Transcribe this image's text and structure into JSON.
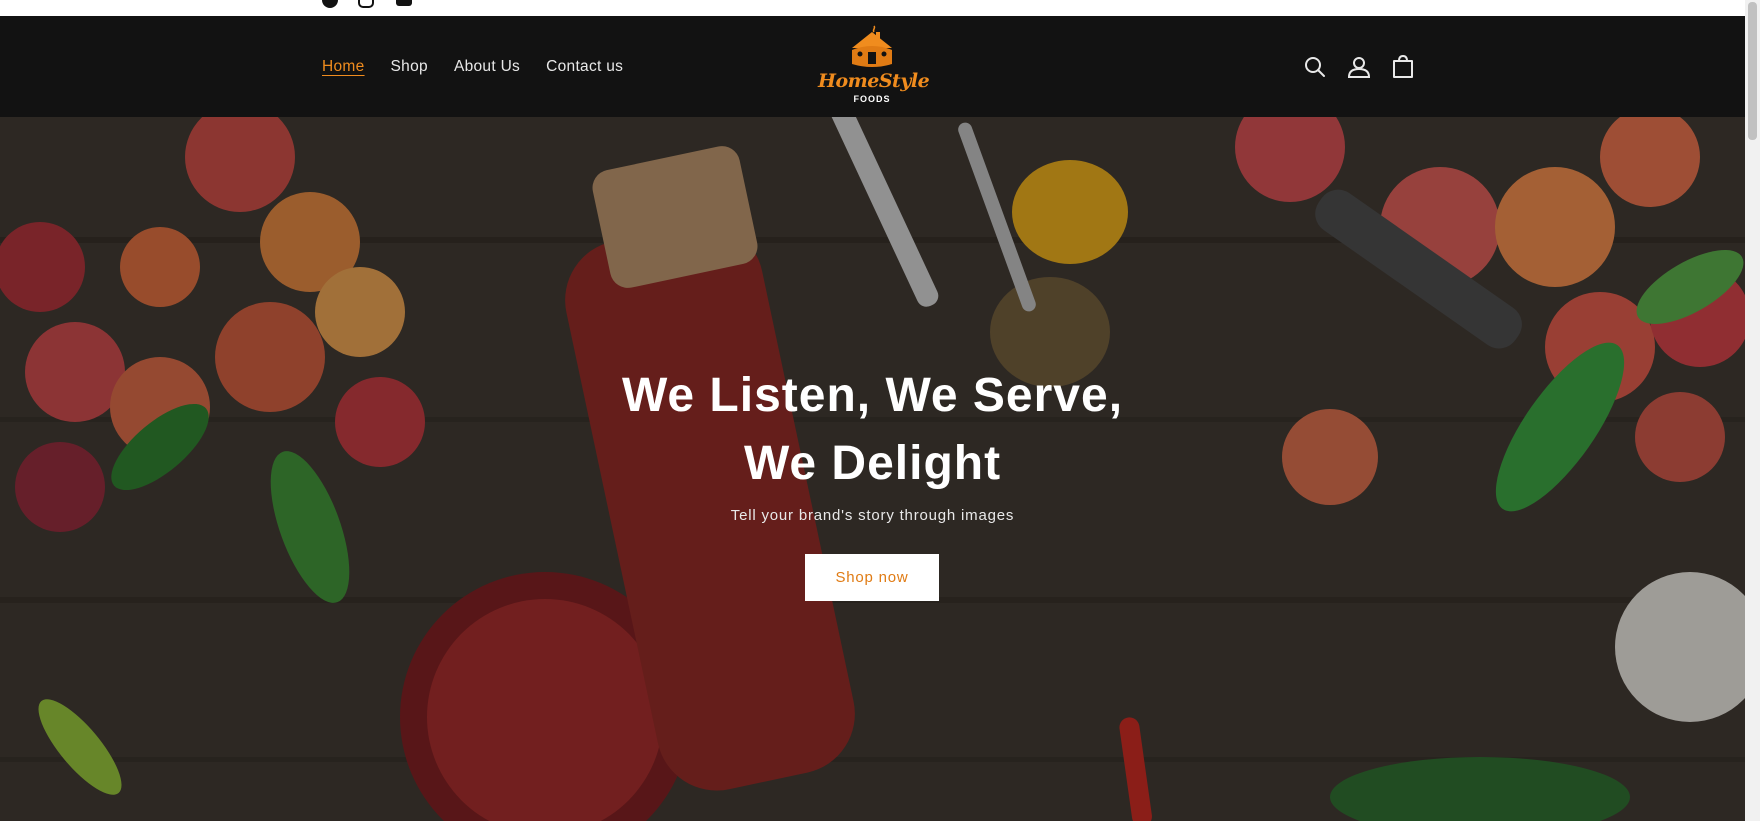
{
  "top_strip": {
    "social_icons": [
      "facebook-icon",
      "instagram-icon",
      "youtube-icon"
    ]
  },
  "header": {
    "nav": [
      {
        "label": "Home",
        "active": true
      },
      {
        "label": "Shop",
        "active": false
      },
      {
        "label": "About Us",
        "active": false
      },
      {
        "label": "Contact us",
        "active": false
      }
    ],
    "logo": {
      "brand": "HomeStyle",
      "sub": "FOODS"
    },
    "icons": [
      "search-icon",
      "account-icon",
      "cart-icon"
    ]
  },
  "hero": {
    "title_line1": "We Listen, We Serve,",
    "title_line2": "We Delight",
    "subtitle": "Tell your brand's story through images",
    "button_label": "Shop now"
  },
  "colors": {
    "accent": "#f08c1e",
    "header_bg": "#121212",
    "button_bg": "#ffffff"
  }
}
